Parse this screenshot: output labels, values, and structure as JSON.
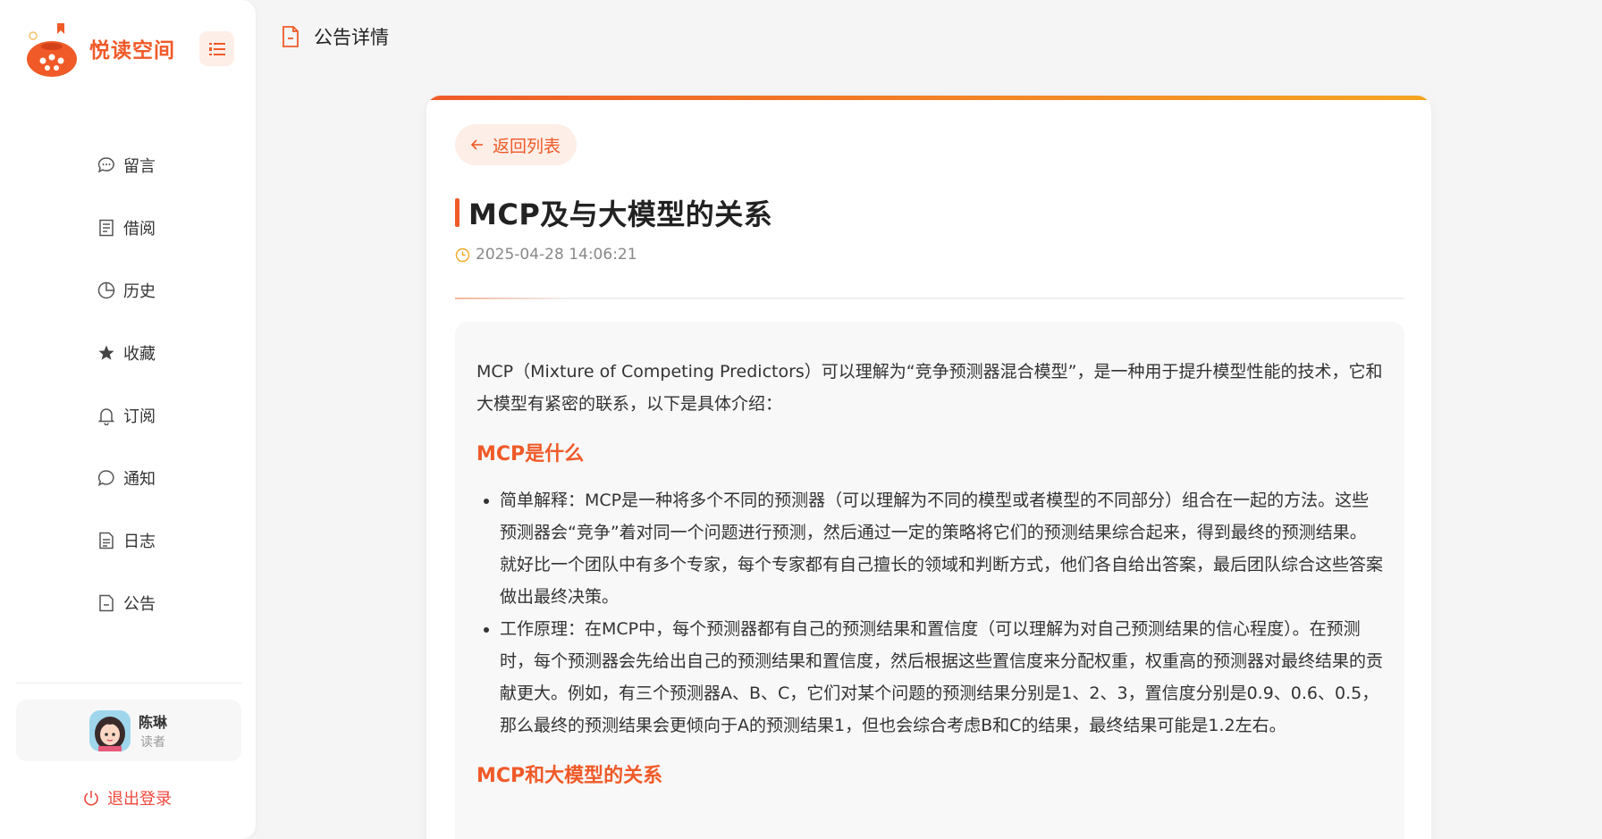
{
  "brand": {
    "name": "悦读空间",
    "accent": "#f05a28"
  },
  "sidebar": {
    "items": [
      {
        "label": "留言",
        "icon": "chat-bubble-icon"
      },
      {
        "label": "借阅",
        "icon": "document-lines-icon"
      },
      {
        "label": "历史",
        "icon": "pie-chart-icon"
      },
      {
        "label": "收藏",
        "icon": "star-icon"
      },
      {
        "label": "订阅",
        "icon": "bell-icon"
      },
      {
        "label": "通知",
        "icon": "message-circle-icon"
      },
      {
        "label": "日志",
        "icon": "document-text-icon"
      },
      {
        "label": "公告",
        "icon": "document-minus-icon"
      }
    ]
  },
  "user": {
    "name": "陈琳",
    "role": "读者"
  },
  "logout_label": "退出登录",
  "header": {
    "title": "公告详情"
  },
  "article": {
    "back_label": "返回列表",
    "title": "MCP及与大模型的关系",
    "timestamp": "2025-04-28 14:06:21",
    "intro": "MCP（Mixture of Competing Predictors）可以理解为“竞争预测器混合模型”，是一种用于提升模型性能的技术，它和大模型有紧密的联系，以下是具体介绍：",
    "section1_heading": "MCP是什么",
    "bullets": [
      "简单解释：MCP是一种将多个不同的预测器（可以理解为不同的模型或者模型的不同部分）组合在一起的方法。这些预测器会“竞争”着对同一个问题进行预测，然后通过一定的策略将它们的预测结果综合起来，得到最终的预测结果。就好比一个团队中有多个专家，每个专家都有自己擅长的领域和判断方式，他们各自给出答案，最后团队综合这些答案做出最终决策。",
      "工作原理：在MCP中，每个预测器都有自己的预测结果和置信度（可以理解为对自己预测结果的信心程度）。在预测时，每个预测器会先给出自己的预测结果和置信度，然后根据这些置信度来分配权重，权重高的预测器对最终结果的贡献更大。例如，有三个预测器A、B、C，它们对某个问题的预测结果分别是1、2、3，置信度分别是0.9、0.6、0.5，那么最终的预测结果会更倾向于A的预测结果1，但也会综合考虑B和C的结果，最终结果可能是1.2左右。"
    ],
    "section2_heading": "MCP和大模型的关系"
  }
}
